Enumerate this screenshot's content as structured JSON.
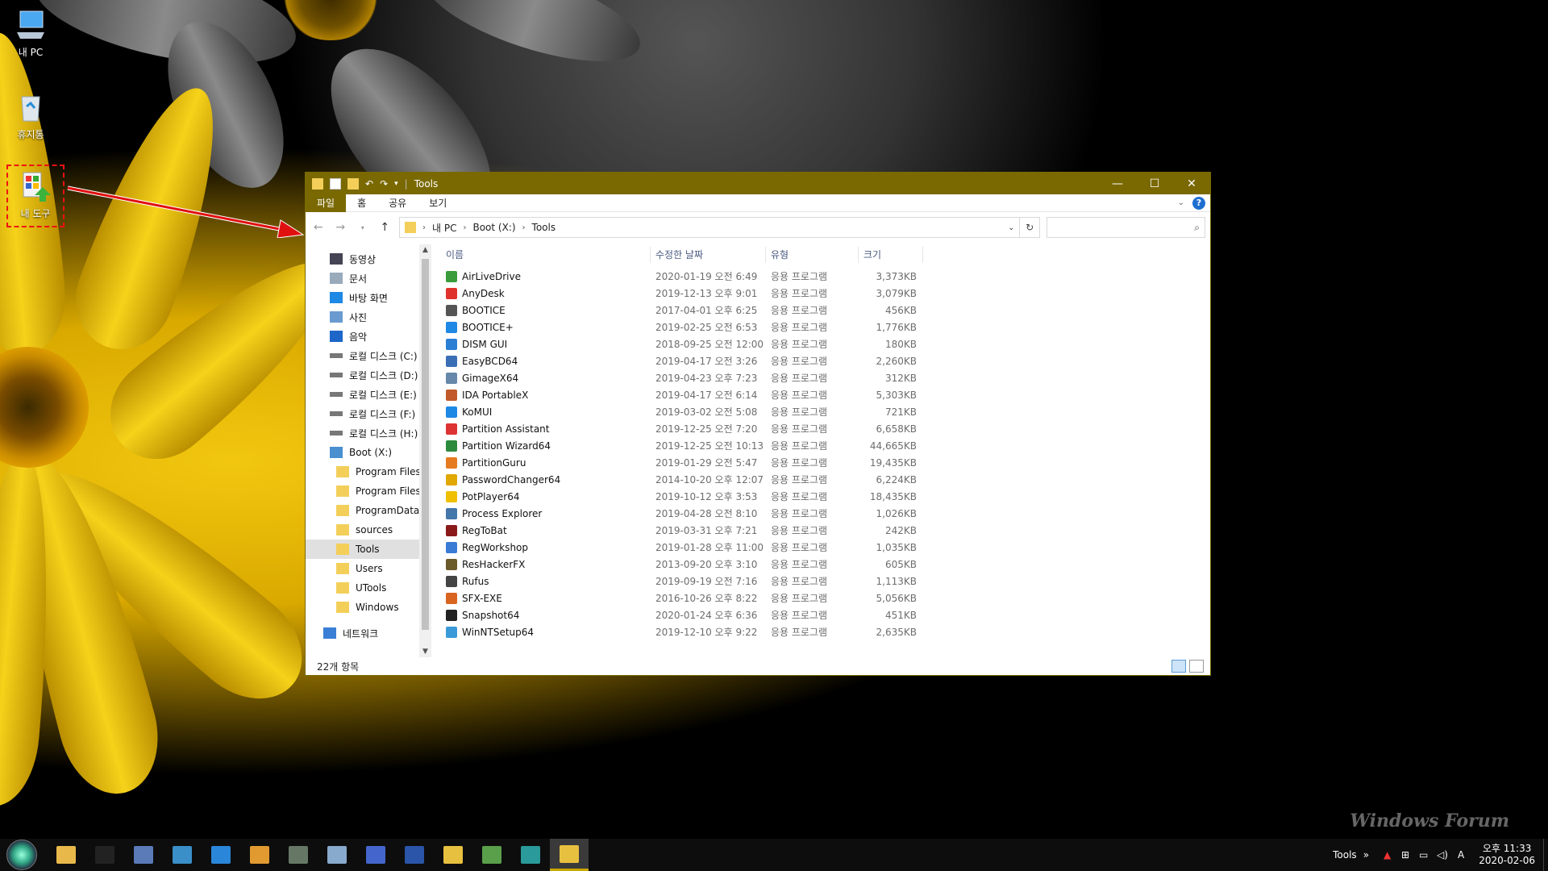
{
  "desktop": {
    "icons": [
      {
        "label": "내 PC",
        "icon": "this-pc-icon"
      },
      {
        "label": "휴지통",
        "icon": "recycle-bin-icon"
      },
      {
        "label": "내 도구",
        "icon": "my-tools-icon"
      }
    ]
  },
  "window": {
    "title": "Tools",
    "controls": {
      "minimize": "—",
      "maximize": "☐",
      "close": "✕"
    },
    "ribbon_tabs": [
      "파일",
      "홈",
      "공유",
      "보기"
    ],
    "help": "?",
    "breadcrumb": [
      "내 PC",
      "Boot (X:)",
      "Tools"
    ],
    "search_placeholder": "",
    "nav_items": [
      {
        "label": "동영상",
        "icon": "videos-icon",
        "indent": 1
      },
      {
        "label": "문서",
        "icon": "documents-icon",
        "indent": 1
      },
      {
        "label": "바탕 화면",
        "icon": "desktop-icon",
        "indent": 1
      },
      {
        "label": "사진",
        "icon": "pictures-icon",
        "indent": 1
      },
      {
        "label": "음악",
        "icon": "music-icon",
        "indent": 1
      },
      {
        "label": "로컬 디스크 (C:)",
        "icon": "drive-icon",
        "indent": 1
      },
      {
        "label": "로컬 디스크 (D:)",
        "icon": "drive-icon",
        "indent": 1
      },
      {
        "label": "로컬 디스크 (E:)",
        "icon": "drive-icon",
        "indent": 1
      },
      {
        "label": "로컬 디스크 (F:)",
        "icon": "drive-icon",
        "indent": 1
      },
      {
        "label": "로컬 디스크 (H:)",
        "icon": "drive-icon",
        "indent": 1
      },
      {
        "label": "Boot (X:)",
        "icon": "boot-drive-icon",
        "indent": 1
      },
      {
        "label": "Program Files",
        "icon": "folder-icon",
        "indent": 2
      },
      {
        "label": "Program Files",
        "icon": "folder-icon",
        "indent": 2
      },
      {
        "label": "ProgramData",
        "icon": "folder-icon",
        "indent": 2
      },
      {
        "label": "sources",
        "icon": "folder-icon",
        "indent": 2
      },
      {
        "label": "Tools",
        "icon": "folder-icon",
        "indent": 2,
        "selected": true
      },
      {
        "label": "Users",
        "icon": "folder-icon",
        "indent": 2
      },
      {
        "label": "UTools",
        "icon": "folder-icon",
        "indent": 2
      },
      {
        "label": "Windows",
        "icon": "folder-icon",
        "indent": 2
      },
      {
        "label": "네트워크",
        "icon": "network-icon",
        "indent": 0
      }
    ],
    "columns": [
      "이름",
      "수정한 날짜",
      "유형",
      "크기"
    ],
    "files": [
      {
        "name": "AirLiveDrive",
        "date": "2020-01-19 오전 6:49",
        "type": "응용 프로그램",
        "size": "3,373KB",
        "color": "#3a9c3a"
      },
      {
        "name": "AnyDesk",
        "date": "2019-12-13 오후 9:01",
        "type": "응용 프로그램",
        "size": "3,079KB",
        "color": "#e0322c"
      },
      {
        "name": "BOOTICE",
        "date": "2017-04-01 오후 6:25",
        "type": "응용 프로그램",
        "size": "456KB",
        "color": "#555555"
      },
      {
        "name": "BOOTICE+",
        "date": "2019-02-25 오전 6:53",
        "type": "응용 프로그램",
        "size": "1,776KB",
        "color": "#1e88e5"
      },
      {
        "name": "DISM GUI",
        "date": "2018-09-25 오전 12:00",
        "type": "응용 프로그램",
        "size": "180KB",
        "color": "#2a7fd4"
      },
      {
        "name": "EasyBCD64",
        "date": "2019-04-17 오전 3:26",
        "type": "응용 프로그램",
        "size": "2,260KB",
        "color": "#3b6fb5"
      },
      {
        "name": "GimageX64",
        "date": "2019-04-23 오후 7:23",
        "type": "응용 프로그램",
        "size": "312KB",
        "color": "#6688aa"
      },
      {
        "name": "IDA PortableX",
        "date": "2019-04-17 오전 6:14",
        "type": "응용 프로그램",
        "size": "5,303KB",
        "color": "#c05a2a"
      },
      {
        "name": "KoMUI",
        "date": "2019-03-02 오전 5:08",
        "type": "응용 프로그램",
        "size": "721KB",
        "color": "#1e88e5"
      },
      {
        "name": "Partition Assistant",
        "date": "2019-12-25 오전 7:20",
        "type": "응용 프로그램",
        "size": "6,658KB",
        "color": "#d33"
      },
      {
        "name": "Partition Wizard64",
        "date": "2019-12-25 오전 10:13",
        "type": "응용 프로그램",
        "size": "44,665KB",
        "color": "#2c8a3c"
      },
      {
        "name": "PartitionGuru",
        "date": "2019-01-29 오전 5:47",
        "type": "응용 프로그램",
        "size": "19,435KB",
        "color": "#e57a1f"
      },
      {
        "name": "PasswordChanger64",
        "date": "2014-10-20 오후 12:07",
        "type": "응용 프로그램",
        "size": "6,224KB",
        "color": "#e0a800"
      },
      {
        "name": "PotPlayer64",
        "date": "2019-10-12 오후 3:53",
        "type": "응용 프로그램",
        "size": "18,435KB",
        "color": "#f0c000"
      },
      {
        "name": "Process Explorer",
        "date": "2019-04-28 오전 8:10",
        "type": "응용 프로그램",
        "size": "1,026KB",
        "color": "#4477aa"
      },
      {
        "name": "RegToBat",
        "date": "2019-03-31 오후 7:21",
        "type": "응용 프로그램",
        "size": "242KB",
        "color": "#8a1a1a"
      },
      {
        "name": "RegWorkshop",
        "date": "2019-01-28 오후 11:00",
        "type": "응용 프로그램",
        "size": "1,035KB",
        "color": "#3a7bd5"
      },
      {
        "name": "ResHackerFX",
        "date": "2013-09-20 오후 3:10",
        "type": "응용 프로그램",
        "size": "605KB",
        "color": "#6b5a2a"
      },
      {
        "name": "Rufus",
        "date": "2019-09-19 오전 7:16",
        "type": "응용 프로그램",
        "size": "1,113KB",
        "color": "#444444"
      },
      {
        "name": "SFX-EXE",
        "date": "2016-10-26 오후 8:22",
        "type": "응용 프로그램",
        "size": "5,056KB",
        "color": "#d9641f"
      },
      {
        "name": "Snapshot64",
        "date": "2020-01-24 오후 6:36",
        "type": "응용 프로그램",
        "size": "451KB",
        "color": "#222222"
      },
      {
        "name": "WinNTSetup64",
        "date": "2019-12-10 오후 9:22",
        "type": "응용 프로그램",
        "size": "2,635KB",
        "color": "#3a9ad9"
      }
    ],
    "status": "22개 항목"
  },
  "taskbar": {
    "apps": [
      {
        "name": "file-explorer-icon",
        "color": "#e8b84a"
      },
      {
        "name": "cmd-icon",
        "color": "#222222"
      },
      {
        "name": "disk-icon",
        "color": "#5a7ab8"
      },
      {
        "name": "network-monitor-icon",
        "color": "#3a8fc8"
      },
      {
        "name": "internet-explorer-icon",
        "color": "#2a86d8"
      },
      {
        "name": "media-player-icon",
        "color": "#e09a30"
      },
      {
        "name": "device-icon",
        "color": "#667766"
      },
      {
        "name": "tool-icon",
        "color": "#88aacc"
      },
      {
        "name": "grid-app-icon",
        "color": "#4466cc"
      },
      {
        "name": "save-icon",
        "color": "#2a55a8"
      },
      {
        "name": "folder-arrow-icon",
        "color": "#e8c040"
      },
      {
        "name": "my-tools-icon",
        "color": "#5aa04a"
      },
      {
        "name": "globe-app-icon",
        "color": "#2a9a9a"
      },
      {
        "name": "explorer-active-icon",
        "color": "#e8c040",
        "active": true
      }
    ],
    "tray_label": "Tools",
    "tray_more": "»",
    "ime": "A",
    "time": "오후 11:33",
    "date": "2020-02-06"
  },
  "watermark": "Windows Forum"
}
